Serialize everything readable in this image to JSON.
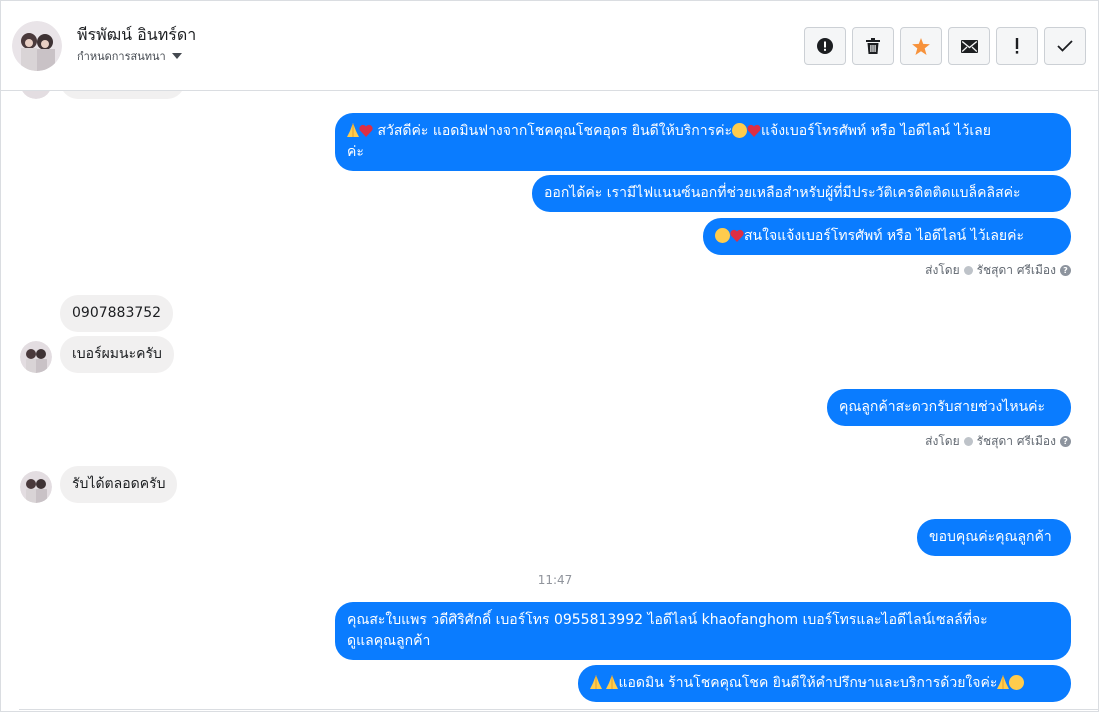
{
  "header": {
    "contact_name": "พีรพัฒน์ อินทร์ดา",
    "assign_label": "กำหนดการสนทนา",
    "toolbar": [
      "report-icon",
      "trash-icon",
      "star-icon",
      "mail-icon",
      "exclamation-icon",
      "check-icon"
    ]
  },
  "messages": {
    "m1_text": " สวัสดีค่ะ แอดมินฟางจากโชคคุณโชคอุดร ยินดีให้บริการค่ะ",
    "m1_text_b": "แจ้งเบอร์โทรศัพท์ หรือ ไอดีไลน์  ไว้เลย",
    "m1_text_c": "ค่ะ",
    "m2_text": "ออกได้ค่ะ เรามีไฟแนนซ์นอกที่ช่วยเหลือสำหรับผู้ที่มีประวัติเครดิตติดแบล็คลิสค่ะ",
    "m3_text": "สนใจแจ้งเบอร์โทรศัพท์ หรือ ไอดีไลน์  ไว้เลยค่ะ",
    "sent_by_1": "ส่งโดย",
    "sent_by_1_name": "รัชสุดา ศรีเมือง",
    "in1_text": "0907883752",
    "in2_text": "เบอร์ผมนะครับ",
    "m4_text": "คุณลูกค้าสะดวกรับสายช่วงไหนค่ะ",
    "sent_by_2": "ส่งโดย",
    "sent_by_2_name": "รัชสุดา ศรีเมือง",
    "in3_text": "รับได้ตลอดครับ",
    "m5_text": "ขอบคุณค่ะคุณลูกค้า",
    "time_divider": "11:47",
    "m6_line1": "คุณสะใบแพร วดีศิริศักดิ์ เบอร์โทร 0955813992  ไอดีไลน์  khaofanghom  เบอร์โทรและไอดีไลน์เซลล์ที่จะ",
    "m6_line2": "ดูแลคุณลูกค้า",
    "m7_text": "แอดมิน ร้านโชคคุณโชค ยินดีให้คำปรึกษาและบริการด้วยใจค่ะ"
  },
  "colors": {
    "outgoing_bubble": "#0a7cff",
    "incoming_bubble": "#f1f0f0",
    "star": "#f7923b"
  }
}
